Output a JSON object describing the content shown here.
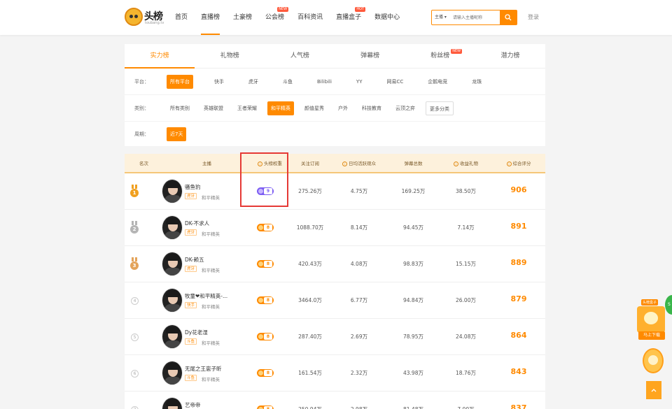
{
  "header": {
    "logo_text": "头榜",
    "logo_sub": "toubang.tv",
    "nav": [
      {
        "label": "首页",
        "active": false,
        "badge": ""
      },
      {
        "label": "直播榜",
        "active": true,
        "badge": ""
      },
      {
        "label": "土豪榜",
        "active": false,
        "badge": ""
      },
      {
        "label": "公会榜",
        "active": false,
        "badge": "NEW"
      },
      {
        "label": "百科资讯",
        "active": false,
        "badge": ""
      },
      {
        "label": "直播盒子",
        "active": false,
        "badge": "HOT"
      },
      {
        "label": "数据中心",
        "active": false,
        "badge": ""
      }
    ],
    "search_type": "主播 ▾",
    "search_placeholder": "请输入主播昵称",
    "login": "登录"
  },
  "filters": {
    "tabs": [
      {
        "label": "实力榜",
        "active": true,
        "badge": ""
      },
      {
        "label": "礼物榜",
        "active": false,
        "badge": ""
      },
      {
        "label": "人气榜",
        "active": false,
        "badge": ""
      },
      {
        "label": "弹幕榜",
        "active": false,
        "badge": ""
      },
      {
        "label": "粉丝榜",
        "active": false,
        "badge": "NEW"
      },
      {
        "label": "潜力榜",
        "active": false,
        "badge": ""
      }
    ],
    "platform_label": "平台：",
    "platforms": [
      "所有平台",
      "快手",
      "虎牙",
      "斗鱼",
      "Bilibili",
      "YY",
      "网易CC",
      "企鹅电竞",
      "龙珠"
    ],
    "category_label": "类别：",
    "categories": [
      "所有类别",
      "英雄联盟",
      "王者荣耀",
      "和平精英",
      "颜值星秀",
      "户外",
      "科技教育",
      "云顶之弈",
      "更多分类"
    ],
    "period_label": "周期：",
    "periods": [
      "近7天"
    ]
  },
  "table": {
    "headers": [
      "名次",
      "主播",
      "头榜权重",
      "关注订阅",
      "日均活跃观众",
      "弹幕总数",
      "收益礼物",
      "综合评分"
    ],
    "rows": [
      {
        "rank": "1",
        "name": "骚鱼豹",
        "platform": "虎牙",
        "category": "和平精英",
        "power": "9",
        "follows": "275.26万",
        "active": "4.75万",
        "danmaku": "169.25万",
        "gifts": "38.50万",
        "score": "906"
      },
      {
        "rank": "2",
        "name": "DK-不求人",
        "platform": "虎牙",
        "category": "和平精英",
        "power": "8",
        "follows": "1088.70万",
        "active": "8.14万",
        "danmaku": "94.45万",
        "gifts": "7.14万",
        "score": "891"
      },
      {
        "rank": "3",
        "name": "DK-赖五",
        "platform": "虎牙",
        "category": "和平精英",
        "power": "8",
        "follows": "420.43万",
        "active": "4.08万",
        "danmaku": "98.83万",
        "gifts": "15.15万",
        "score": "889"
      },
      {
        "rank": "4",
        "name": "牧童❤和平精英-...",
        "platform": "快手",
        "category": "和平精英",
        "power": "8",
        "follows": "3464.0万",
        "active": "6.77万",
        "danmaku": "94.84万",
        "gifts": "26.00万",
        "score": "879"
      },
      {
        "rank": "5",
        "name": "Dy花老湿",
        "platform": "斗鱼",
        "category": "和平精英",
        "power": "8",
        "follows": "287.40万",
        "active": "2.69万",
        "danmaku": "78.95万",
        "gifts": "24.08万",
        "score": "864"
      },
      {
        "rank": "6",
        "name": "无尾之王崽子昕",
        "platform": "斗鱼",
        "category": "和平精英",
        "power": "8",
        "follows": "161.54万",
        "active": "2.32万",
        "danmaku": "43.98万",
        "gifts": "18.76万",
        "score": "843"
      },
      {
        "rank": "7",
        "name": "艺帝帝",
        "platform": "",
        "category": "",
        "power": "8",
        "follows": "250.94万",
        "active": "2.98万",
        "danmaku": "81.48万",
        "gifts": "7.00万",
        "score": "837"
      }
    ]
  },
  "side": {
    "promo_tag": "头榜盒子",
    "promo_download": "马上下载"
  },
  "colors": {
    "accent": "#ff8a00",
    "gold": "#f0a020",
    "silver": "#b5b5b5",
    "bronze": "#e3a35a",
    "power_purple": "#7b5cf2"
  }
}
